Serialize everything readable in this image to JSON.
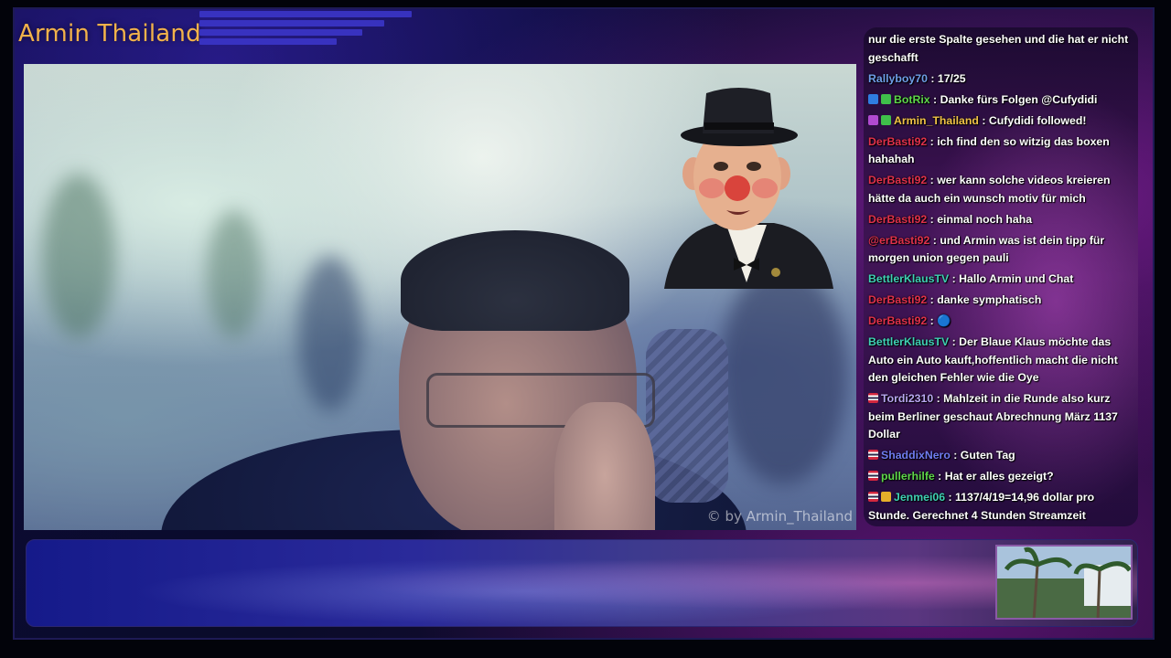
{
  "channel": {
    "name": "Armin Thailand",
    "watermark": "© by Armin_Thailand"
  },
  "colors": {
    "brand_text": "#f2b24a",
    "accent_blue": "#3b35c8",
    "chat_bg": "#3c1450"
  },
  "chat": {
    "messages": [
      {
        "user": "",
        "color": "#ffffff",
        "badges": [],
        "text": "nur die erste Spalte gesehen und die hat er nicht geschafft"
      },
      {
        "user": "Rallyboy70",
        "color": "#6f9ee8",
        "badges": [],
        "text": "17/25"
      },
      {
        "user": "BotRix",
        "color": "#5ed64a",
        "badges": [
          "bot-icon",
          "verified-icon"
        ],
        "text": "Danke fürs Folgen @Cufydidi"
      },
      {
        "user": "Armin_Thailand",
        "color": "#f0c246",
        "badges": [
          "broadcaster-icon",
          "verified-icon"
        ],
        "text": "Cufydidi followed!"
      },
      {
        "user": "DerBasti92",
        "color": "#e0314a",
        "badges": [],
        "text": "ich find den so witzig das boxen hahahah"
      },
      {
        "user": "DerBasti92",
        "color": "#e0314a",
        "badges": [],
        "text": "wer kann solche videos kreieren hätte da auch ein wunsch motiv für mich"
      },
      {
        "user": "DerBasti92",
        "color": "#e0314a",
        "badges": [],
        "text": "einmal noch haha"
      },
      {
        "user": "@erBasti92",
        "color": "#e0314a",
        "badges": [],
        "text": "und Armin was ist dein tipp für morgen union gegen pauli"
      },
      {
        "user": "BettlerKlausTV",
        "color": "#3fd0b4",
        "badges": [],
        "text": "Hallo Armin und Chat"
      },
      {
        "user": "DerBasti92",
        "color": "#e0314a",
        "badges": [],
        "text": "danke symphatisch"
      },
      {
        "user": "DerBasti92",
        "color": "#e0314a",
        "badges": [],
        "text": "🔵"
      },
      {
        "user": "BettlerKlausTV",
        "color": "#3fd0b4",
        "badges": [],
        "text": "Der Blaue Klaus möchte das Auto ein Auto kauft,hoffentlich macht die nicht den gleichen Fehler wie die Oye"
      },
      {
        "user": "Tordi2310",
        "color": "#b8a7f0",
        "badges": [
          "thai-flag-icon"
        ],
        "text": "Mahlzeit in die Runde also kurz beim Berliner geschaut Abrechnung März 1137 Dollar"
      },
      {
        "user": "ShaddixNero",
        "color": "#6f7cf0",
        "badges": [
          "thai-flag-icon"
        ],
        "text": "Guten Tag"
      },
      {
        "user": "pullerhilfe",
        "color": "#5ed64a",
        "badges": [
          "thai-flag-icon"
        ],
        "text": "Hat er alles gezeigt?"
      },
      {
        "user": "Jenmei06",
        "color": "#3fd0b4",
        "badges": [
          "thai-flag-icon",
          "sub-icon"
        ],
        "text": "1137/4/19=14,96 dollar pro Stunde. Gerechnet 4 Stunden Streamzeit"
      }
    ]
  }
}
